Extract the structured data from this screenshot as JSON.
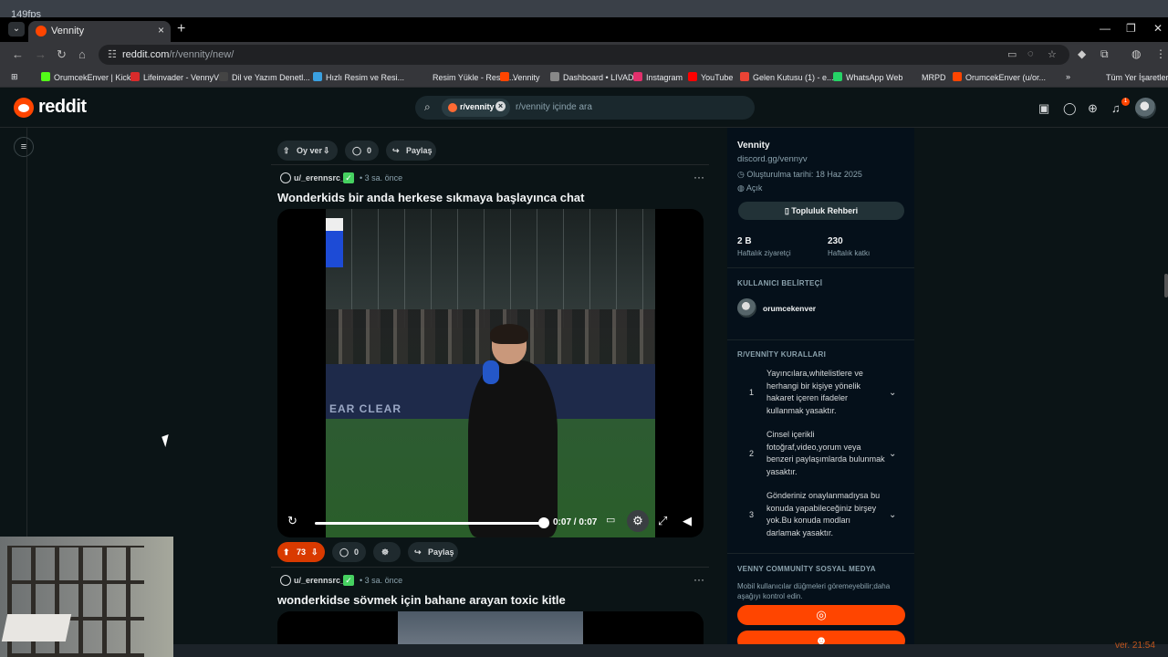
{
  "desktop": {
    "fps": "149fps",
    "version": "ver. 21:54"
  },
  "browser": {
    "tab_title": "Vennity",
    "url_host": "reddit.com",
    "url_path": "/r/vennity/new/",
    "bookmarks": [
      {
        "label": "OrumcekEnver | Kick",
        "color": "#53fc18"
      },
      {
        "label": "Lifeinvader - VennyV",
        "color": "#d92b2b"
      },
      {
        "label": "Dil ve Yazım Denetl...",
        "color": "#444"
      },
      {
        "label": "Hızlı Resim ve Resi...",
        "color": "#3aa0e0"
      },
      {
        "label": "Resim Yükle - Resim...",
        "color": "#35363a"
      },
      {
        "label": "Vennity",
        "color": "#ff4500"
      },
      {
        "label": "Dashboard • LIVAD",
        "color": "#888"
      },
      {
        "label": "Instagram",
        "color": "#e1306c"
      },
      {
        "label": "YouTube",
        "color": "#ff0000"
      },
      {
        "label": "Gelen Kutusu (1) - e...",
        "color": "#ea4335"
      },
      {
        "label": "WhatsApp Web",
        "color": "#25d366"
      },
      {
        "label": "MRPD",
        "color": "#35363a"
      },
      {
        "label": "OrumcekEnver (u/or...",
        "color": "#ff4500"
      },
      {
        "label": "Tüm Yer İşaretleri",
        "color": "#35363a"
      }
    ]
  },
  "reddit": {
    "logo": "reddit",
    "search": {
      "chip": "r/vennity",
      "placeholder": "r/vennity içinde ara"
    },
    "notification_count": "1"
  },
  "feed": {
    "prev_post": {
      "vote_label": "Oy ver",
      "comments": "0",
      "share": "Paylaş"
    },
    "post1": {
      "user": "u/_erennsrc_",
      "time": "3 sa. önce",
      "title": "Wonderkids bir anda herkese sıkmaya başlayınca chat",
      "video_time": "0:07 / 0:07",
      "video_wall_text": "EAR CLEAR",
      "score": "73",
      "comments": "0",
      "share": "Paylaş"
    },
    "post2": {
      "user": "u/_erennsrc_",
      "time": "3 sa. önce",
      "title": "wonderkidse sövmek için bahane arayan toxic kitle"
    }
  },
  "sidebar": {
    "community_name": "Vennity",
    "community_desc": "discord.gg/vennyv",
    "created": "Oluşturulma tarihi: 18 Haz 2025",
    "visibility": "Açık",
    "guide_button": "Topluluk Rehberi",
    "stats": [
      {
        "value": "2 B",
        "label": "Haftalık ziyaretçi"
      },
      {
        "value": "230",
        "label": "Haftalık katkı"
      }
    ],
    "flair_section": "KULLANICI BELİRTEÇİ",
    "flair_user": "orumcekenver",
    "rules_section": "R/VENNİTY KURALLARI",
    "rules": [
      {
        "num": "1",
        "text": "Yayıncılara,whitelistlere ve herhangi bir kişiye yönelik hakaret içeren ifadeler kullanmak yasaktır."
      },
      {
        "num": "2",
        "text": "Cinsel içerikli fotoğraf,video,yorum veya benzeri paylaşımlarda bulunmak yasaktır."
      },
      {
        "num": "3",
        "text": "Gönderiniz onaylanmadıysa bu konuda yapabileceğiniz birşey yok.Bu konuda modları darlamak yasaktır."
      }
    ],
    "social_section": "VENNY COMMUNİTY SOSYAL MEDYA",
    "social_desc": "Mobil kullanıcılar düğmeleri göremeyebilir;daha aşağıyı kontrol edin."
  }
}
